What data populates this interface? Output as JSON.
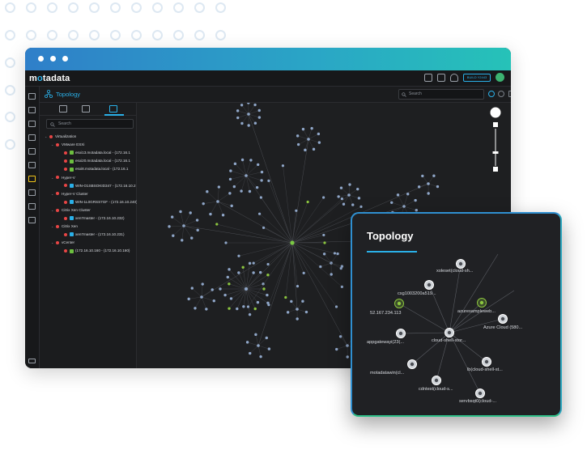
{
  "app": {
    "logo_prefix": "m",
    "logo_o": "o",
    "logo_suffix": "tadata",
    "header_button": "BUILD Y2443"
  },
  "subbar": {
    "title": "Topology",
    "search_placeholder": "Search"
  },
  "tree": {
    "search_placeholder": "Search",
    "nodes": [
      {
        "label": "Virtualization",
        "level": 0,
        "icon": "status-dot",
        "color": "#e84545"
      },
      {
        "label": "VMware ESXi",
        "level": 1,
        "icon": "status-dot",
        "color": "#e84545"
      },
      {
        "label": "esxi13.motadata.local - (172.16.1",
        "level": 2,
        "icon": "vm-icon",
        "color": "#6cbf3f"
      },
      {
        "label": "esxi20.motadata.local - (172.16.1",
        "level": 2,
        "icon": "vm-icon",
        "color": "#6cbf3f"
      },
      {
        "label": "esxi8.motadata.local - (172.16.1",
        "level": 2,
        "icon": "vm-icon",
        "color": "#6cbf3f"
      },
      {
        "label": "Hyper-V",
        "level": 1,
        "icon": "status-dot",
        "color": "#e84545"
      },
      {
        "label": "WIN-O1SBSOKID347 - (172.16.10.2",
        "level": 2,
        "icon": "hyperv-icon",
        "color": "#2ab0e8"
      },
      {
        "label": "Hyper-V Cluster",
        "level": 1,
        "icon": "status-dot",
        "color": "#e84545"
      },
      {
        "label": "WIN-1L0GRSS7GF - (172.16.10.240)",
        "level": 2,
        "icon": "hyperv-icon",
        "color": "#2ab0e8"
      },
      {
        "label": "Citrix Xen Cluster",
        "level": 1,
        "icon": "status-dot",
        "color": "#e84545"
      },
      {
        "label": "xen7master - (172.16.10.232)",
        "level": 2,
        "icon": "xen-icon",
        "color": "#2ab0e8"
      },
      {
        "label": "Citrix Xen",
        "level": 1,
        "icon": "status-dot",
        "color": "#e84545"
      },
      {
        "label": "xen7master - (172.16.10.231)",
        "level": 2,
        "icon": "xen-icon",
        "color": "#2ab0e8"
      },
      {
        "label": "vCenter",
        "level": 1,
        "icon": "status-dot",
        "color": "#e84545"
      },
      {
        "label": "(172.16.10.160 - (172.16.10.160)",
        "level": 2,
        "icon": "vm-icon",
        "color": "#6cbf3f"
      }
    ]
  },
  "card": {
    "title": "Topology",
    "nodes": [
      {
        "label": "xoleset(cloud-sh...",
        "icon": "cloud-icon"
      },
      {
        "label": "csg1003200a519...",
        "icon": "cloud-icon"
      },
      {
        "label": "52.167.234.113",
        "icon": "ip-icon"
      },
      {
        "label": "azuresampleweb...",
        "icon": "cloud-icon"
      },
      {
        "label": "Azure Cloud (580...",
        "icon": "azure-icon"
      },
      {
        "label": "appgatewayi(23(...",
        "icon": "cloud-icon"
      },
      {
        "label": "cloud-shell-stor...",
        "icon": "cloud-icon"
      },
      {
        "label": "lb(cloud-shell-st...",
        "icon": "cloud-icon"
      },
      {
        "label": "motadatawin(cl...",
        "icon": "cloud-icon"
      },
      {
        "label": "cdntest(cloud-s...",
        "icon": "cloud-icon"
      },
      {
        "label": "servbsqt0(cloud-...",
        "icon": "cloud-icon"
      }
    ]
  },
  "colors": {
    "accent": "#2ab0e8",
    "node": "#8fa6c8",
    "node_green": "#8cc63f",
    "hub": "#7ac943",
    "status_red": "#e84545"
  }
}
